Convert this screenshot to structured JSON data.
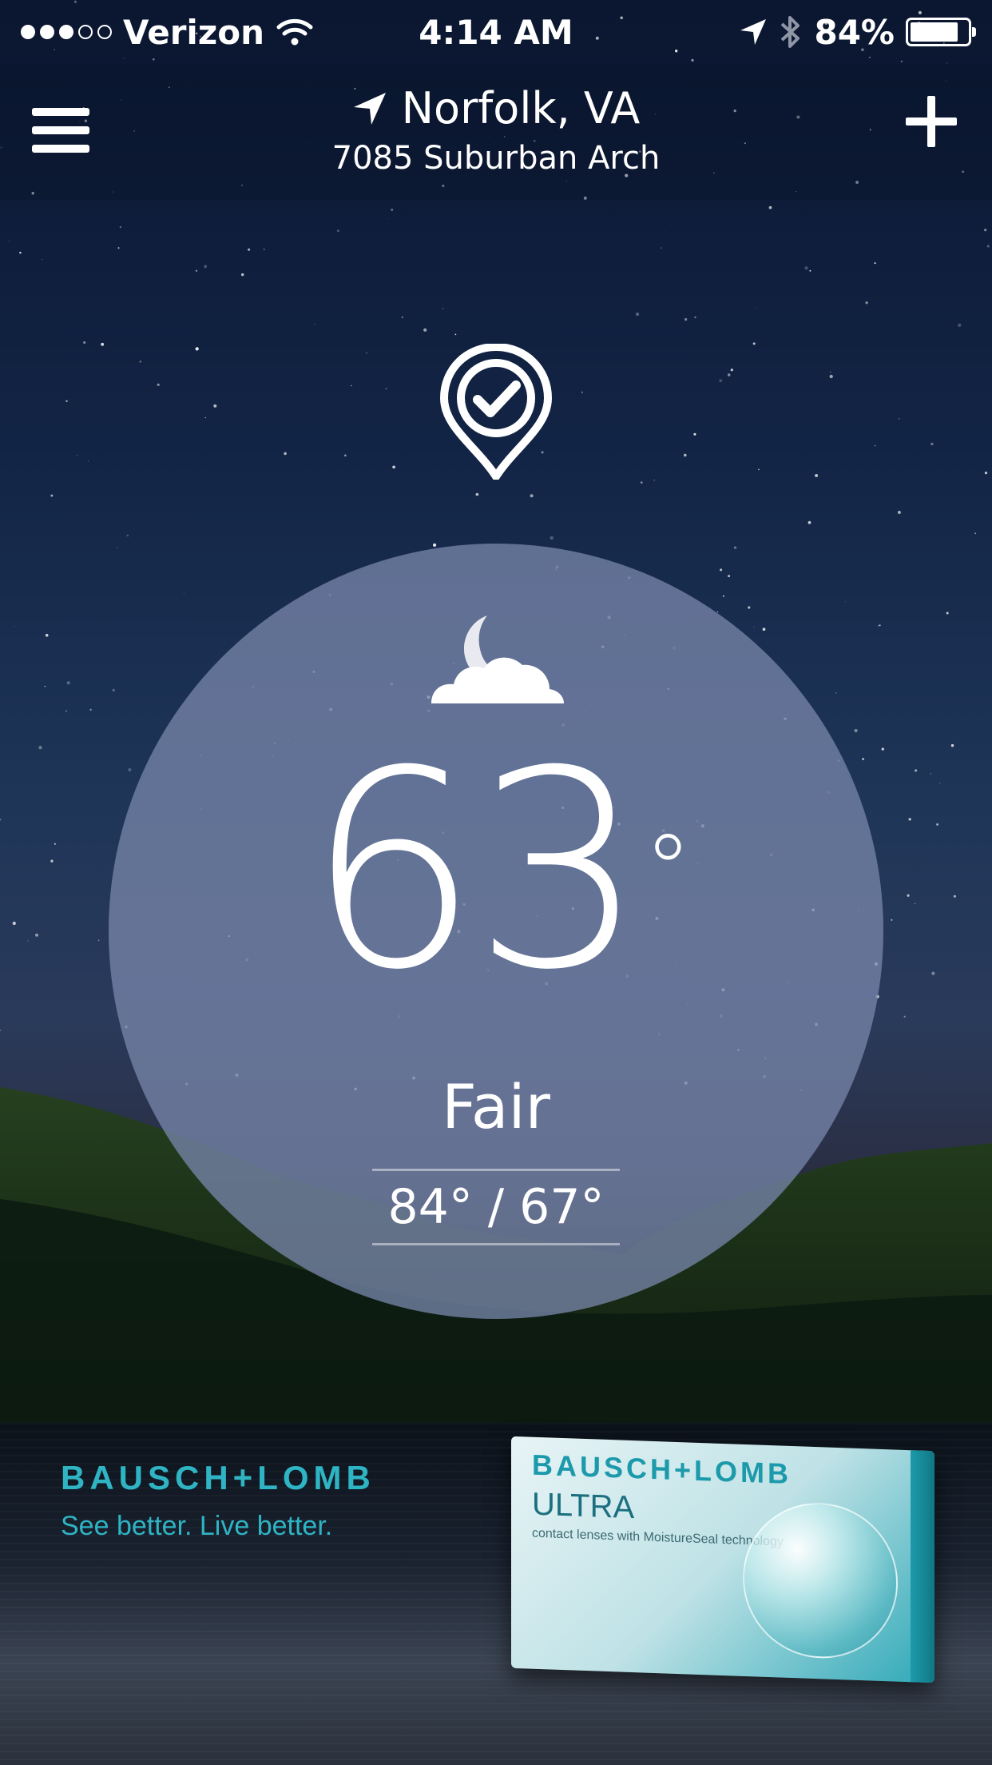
{
  "status_bar": {
    "carrier": "Verizon",
    "time": "4:14 AM",
    "battery": "84%",
    "battery_level": 0.84,
    "signal_bars_on": 3,
    "signal_bars_total": 5
  },
  "nav": {
    "city": "Norfolk, VA",
    "address": "7085 Suburban Arch"
  },
  "weather": {
    "temperature": "63",
    "degree_symbol": "°",
    "condition": "Fair",
    "high_low": "84° / 67°",
    "icon": "moon-cloud-icon"
  },
  "ad": {
    "brand": "BAUSCH+LOMB",
    "tagline": "See better. Live better.",
    "box_brand": "BAUSCH+LOMB",
    "box_product": "ULTRA",
    "box_sub": "contact lenses with MoistureSeal technology"
  },
  "colors": {
    "ad_accent": "#2fb4c4",
    "circle_fill": "#7684a8"
  }
}
